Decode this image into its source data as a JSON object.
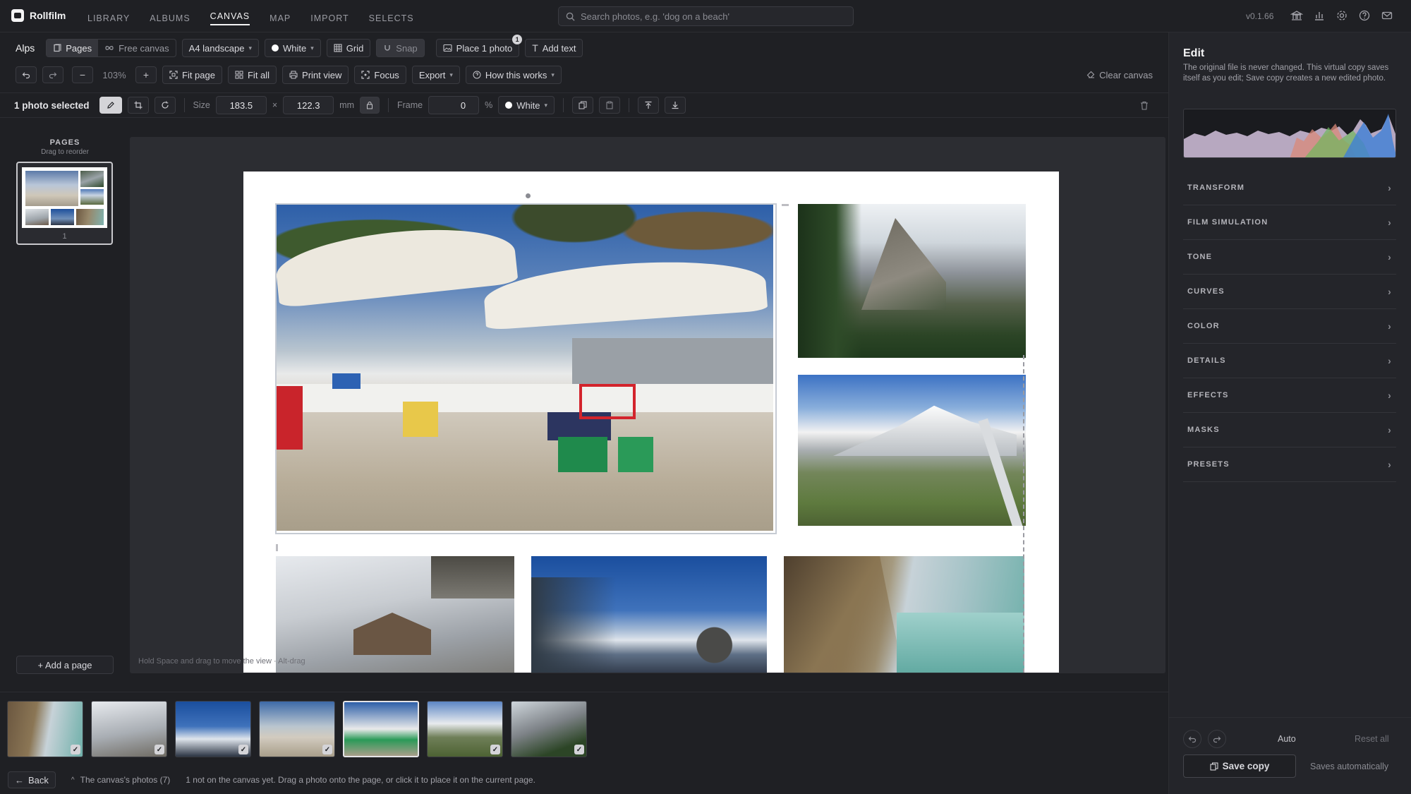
{
  "app": {
    "name": "Rollfilm",
    "version": "v0.1.66"
  },
  "nav": {
    "library": "LIBRARY",
    "albums": "ALBUMS",
    "canvas": "CANVAS",
    "map": "MAP",
    "import": "IMPORT",
    "selects": "SELECTS"
  },
  "search": {
    "placeholder": "Search photos, e.g. 'dog on a beach'"
  },
  "toolbar1": {
    "album": "Alps",
    "pages": "Pages",
    "free_canvas": "Free canvas",
    "paper": "A4 landscape",
    "background": "White",
    "grid": "Grid",
    "snap": "Snap",
    "place": "Place 1 photo",
    "place_badge": "1",
    "add_text": "Add text"
  },
  "toolbar2": {
    "zoom": "103%",
    "fit_page": "Fit page",
    "fit_all": "Fit all",
    "print_view": "Print view",
    "focus": "Focus",
    "export": "Export",
    "how": "How this works",
    "clear": "Clear canvas"
  },
  "toolbar3": {
    "selection": "1 photo selected",
    "size_label": "Size",
    "width": "183.5",
    "times": "×",
    "height": "122.3",
    "unit": "mm",
    "frame_label": "Frame",
    "frame": "0",
    "percent": "%",
    "frame_color": "White"
  },
  "pages_panel": {
    "title": "PAGES",
    "subtitle": "Drag to reorder",
    "page_number": "1",
    "add_page": "+ Add a page"
  },
  "canvas": {
    "hint": "Hold Space and drag to move the view · Alt-drag"
  },
  "edit": {
    "title": "Edit",
    "description": "The original file is never changed. This virtual copy saves itself as you edit; Save copy creates a new edited photo.",
    "sections": [
      "TRANSFORM",
      "FILM SIMULATION",
      "TONE",
      "CURVES",
      "COLOR",
      "DETAILS",
      "EFFECTS",
      "MASKS",
      "PRESETS"
    ],
    "auto": "Auto",
    "reset": "Reset all",
    "save": "Save copy",
    "saves_auto": "Saves automatically"
  },
  "footer": {
    "back": "Back",
    "photos_toggle": "The canvas's photos (7)",
    "status": "1 not on the canvas yet. Drag a photo onto the page, or click it to place it on the current page."
  },
  "icons": [
    "logo-icon",
    "search-icon",
    "bank-icon",
    "chart-icon",
    "gear-icon",
    "help-icon",
    "mail-icon"
  ],
  "colors": {
    "accent": "#f4f4f5",
    "panel": "#24252a",
    "background": "#1f2024",
    "canvas": "#2c2d32"
  }
}
